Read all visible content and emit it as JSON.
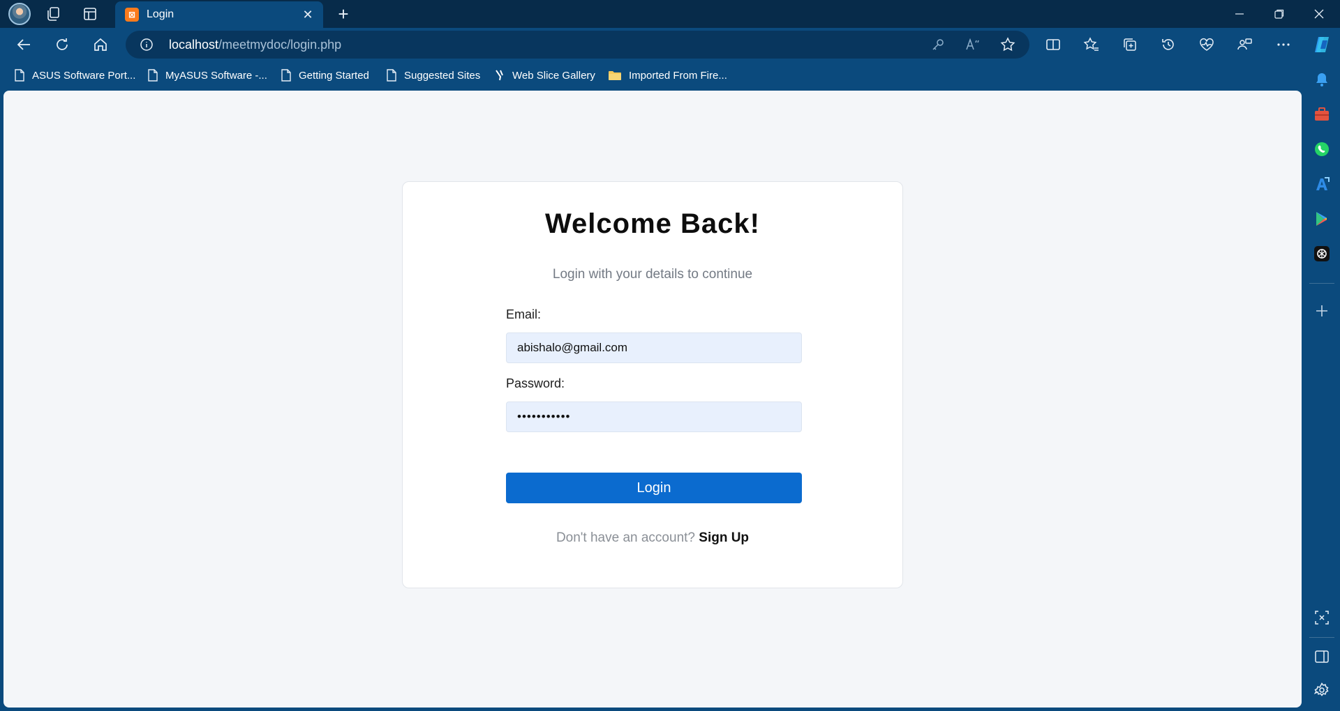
{
  "browser": {
    "tab": {
      "title": "Login",
      "favicon": "xampp-icon",
      "close": "close-icon"
    },
    "new_tab": "plus-icon",
    "window_controls": [
      "minimize-icon",
      "restore-icon",
      "close-icon"
    ],
    "nav": [
      "back-icon",
      "refresh-icon",
      "home-icon"
    ],
    "address": {
      "host": "localhost",
      "path": "/meetmydoc/login.php",
      "icons": [
        "site-info-icon",
        "key-icon",
        "read-aloud-icon",
        "favorite-star-icon"
      ]
    },
    "toolbar_icons": [
      "split-screen-icon",
      "favorites-icon",
      "collections-icon",
      "history-icon",
      "performance-icon",
      "workspaces-icon",
      "more-icon",
      "copilot-icon"
    ],
    "favorites_bar": [
      {
        "label": "ASUS Software Port...",
        "icon": "page-icon"
      },
      {
        "label": "MyASUS Software -...",
        "icon": "page-icon"
      },
      {
        "label": "Getting Started",
        "icon": "page-icon"
      },
      {
        "label": "Suggested Sites",
        "icon": "page-icon"
      },
      {
        "label": "Web Slice Gallery",
        "icon": "web-slice-icon"
      },
      {
        "label": "Imported From Fire...",
        "icon": "folder-icon"
      }
    ],
    "sidebar_icons": [
      "bell-icon",
      "toolbox-icon",
      "whatsapp-icon",
      "translator-icon",
      "play-store-icon",
      "chatgpt-icon",
      "add-icon",
      "screenshot-icon",
      "hide-sidebar-icon",
      "settings-icon"
    ]
  },
  "page": {
    "title": "Welcome Back!",
    "subtitle": "Login with your details to continue",
    "email": {
      "label": "Email:",
      "value": "abishalo@gmail.com"
    },
    "password": {
      "label": "Password:",
      "value": "•••••••••••"
    },
    "login_button": "Login",
    "signup_prompt": "Don't have an account?",
    "signup_link": "Sign Up"
  },
  "colors": {
    "frame": "#0b4a7d",
    "page_background": "#f4f6f9",
    "input_background": "#e8f0fd",
    "primary_button": "#0b6bcf"
  }
}
